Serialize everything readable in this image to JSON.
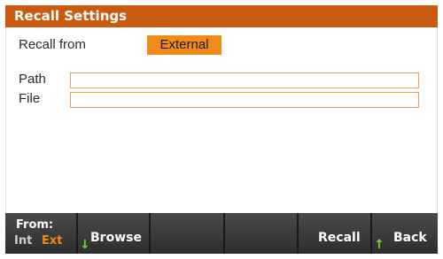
{
  "title": "Recall Settings",
  "recall_from": {
    "label": "Recall from",
    "value": "External"
  },
  "fields": {
    "path_label": "Path",
    "path_value": "",
    "file_label": "File",
    "file_value": ""
  },
  "softkeys": {
    "from_label": "From:",
    "from_int": "Int",
    "from_ext": "Ext",
    "browse": "Browse",
    "key3": "",
    "key4": "",
    "recall": "Recall",
    "back": "Back"
  },
  "icons": {
    "down_arrow": "↓",
    "up_arrow": "↑"
  },
  "colors": {
    "accent": "#f08a18",
    "title_bar": "#c95a10",
    "arrow_green": "#66dd33"
  }
}
